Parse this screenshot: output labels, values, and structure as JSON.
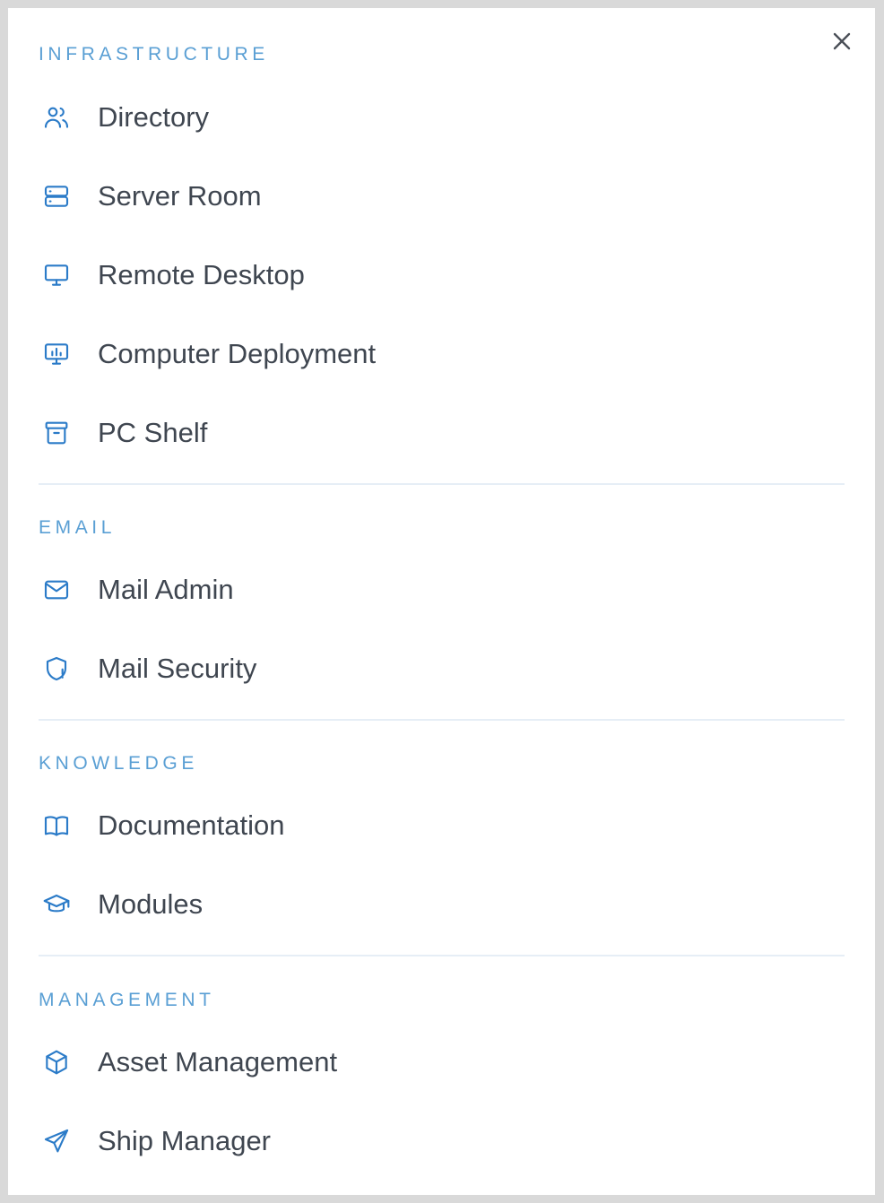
{
  "close_label": "close",
  "colors": {
    "accent": "#2b7bc8",
    "section_label": "#5a9fd4",
    "item_text": "#3f4650",
    "divider": "#e6eef6"
  },
  "sections": [
    {
      "title": "INFRASTRUCTURE",
      "items": [
        {
          "label": "Directory",
          "icon": "users-icon"
        },
        {
          "label": "Server Room",
          "icon": "server-icon"
        },
        {
          "label": "Remote Desktop",
          "icon": "monitor-icon"
        },
        {
          "label": "Computer Deployment",
          "icon": "monitor-chart-icon"
        },
        {
          "label": "PC Shelf",
          "icon": "archive-box-icon"
        }
      ]
    },
    {
      "title": "EMAIL",
      "items": [
        {
          "label": "Mail Admin",
          "icon": "envelope-icon"
        },
        {
          "label": "Mail Security",
          "icon": "shield-exclamation-icon"
        }
      ]
    },
    {
      "title": "KNOWLEDGE",
      "items": [
        {
          "label": "Documentation",
          "icon": "book-icon"
        },
        {
          "label": "Modules",
          "icon": "graduation-cap-icon"
        }
      ]
    },
    {
      "title": "MANAGEMENT",
      "items": [
        {
          "label": "Asset Management",
          "icon": "cube-icon"
        },
        {
          "label": "Ship Manager",
          "icon": "paper-plane-icon"
        }
      ]
    }
  ]
}
